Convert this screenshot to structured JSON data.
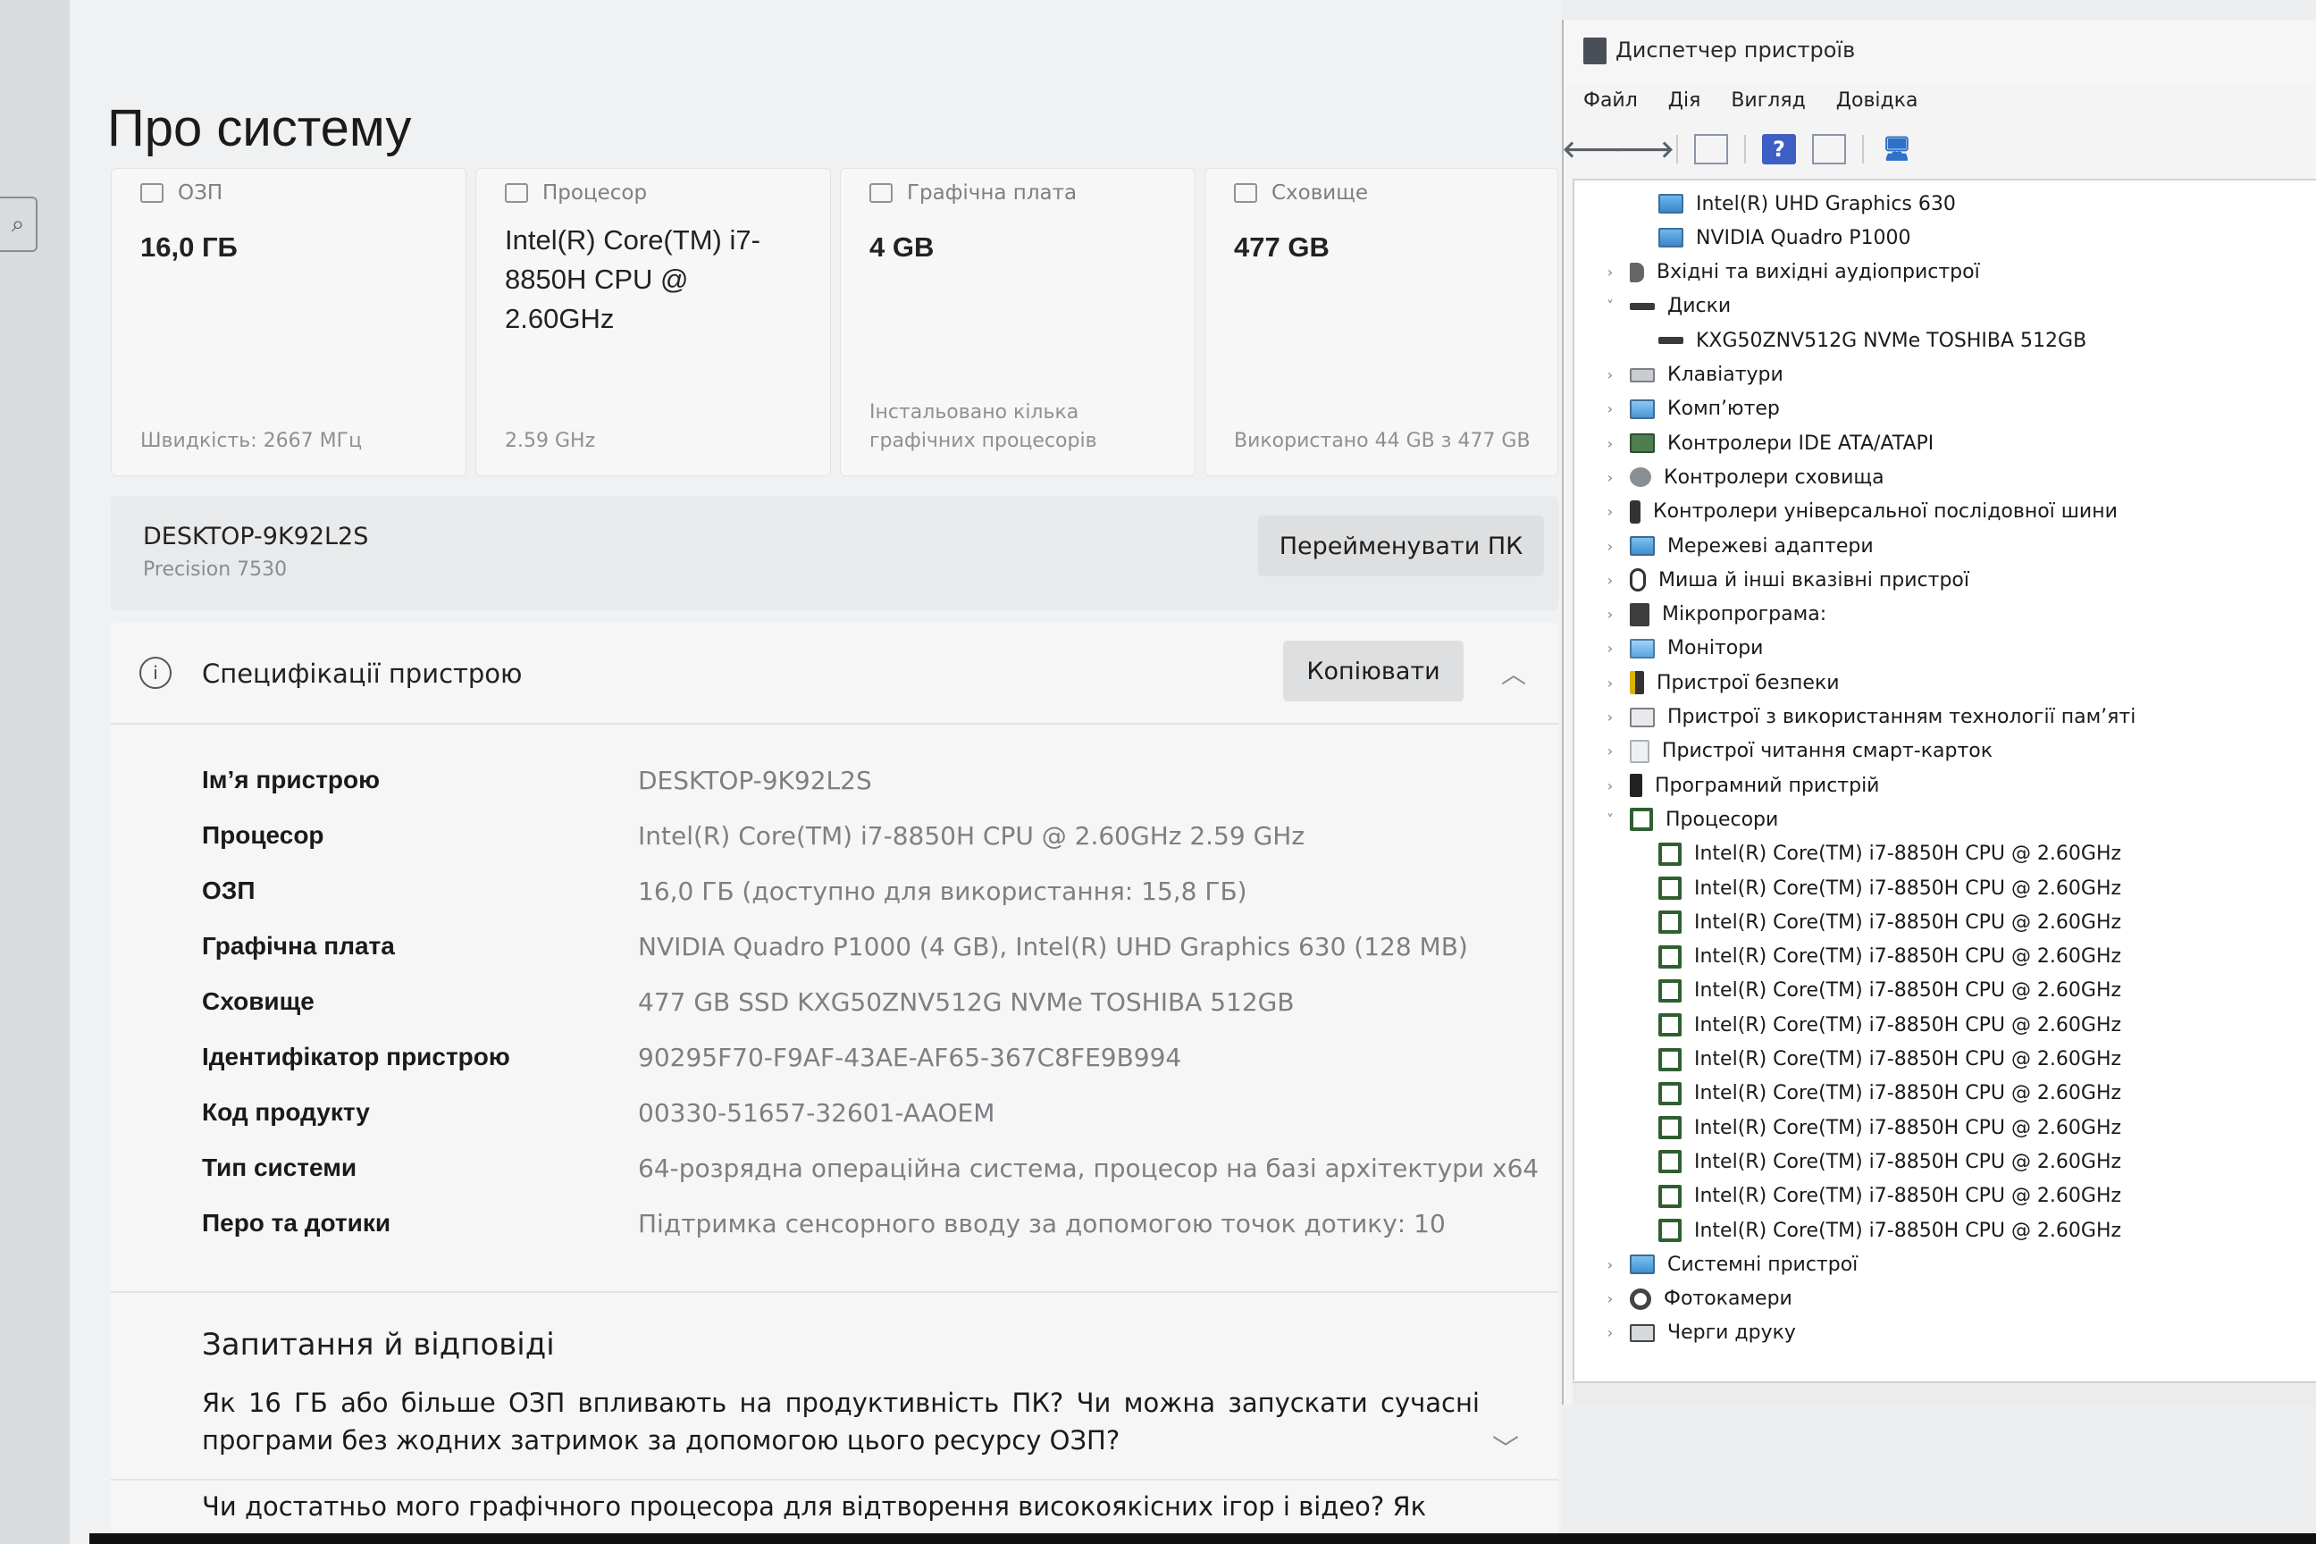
{
  "settings": {
    "page_title": "Про систему",
    "cards": [
      {
        "label": "ОЗП",
        "value": "16,0 ГБ",
        "footer": "Швидкість: 2667 МГц"
      },
      {
        "label": "Процесор",
        "value": "Intel(R) Core(TM) i7-8850H CPU @ 2.60GHz",
        "footer": "2.59 GHz"
      },
      {
        "label": "Графічна плата",
        "value": "4 GB",
        "footer": "Інстальовано кілька графічних процесорів"
      },
      {
        "label": "Сховище",
        "value": "477 GB",
        "footer": "Використано 44 GB з 477 GB"
      }
    ],
    "pc_name": "DESKTOP-9K92L2S",
    "pc_model": "Precision 7530",
    "rename_button": "Перейменувати ПК",
    "spec_title": "Специфікації пристрою",
    "copy_button": "Копіювати",
    "specs": [
      {
        "label": "Ім’я пристрою",
        "value": "DESKTOP-9K92L2S"
      },
      {
        "label": "Процесор",
        "value": "Intel(R) Core(TM) i7-8850H CPU @ 2.60GHz   2.59 GHz"
      },
      {
        "label": "ОЗП",
        "value": "16,0 ГБ (доступно для використання: 15,8 ГБ)"
      },
      {
        "label": "Графічна плата",
        "value": "NVIDIA Quadro P1000 (4 GB), Intel(R) UHD Graphics 630 (128 MB)"
      },
      {
        "label": "Сховище",
        "value": "477 GB SSD KXG50ZNV512G NVMe TOSHIBA 512GB"
      },
      {
        "label": "Ідентифікатор пристрою",
        "value": "90295F70-F9AF-43AE-AF65-367C8FE9B994"
      },
      {
        "label": "Код продукту",
        "value": "00330-51657-32601-AAOEM"
      },
      {
        "label": "Тип системи",
        "value": "64-розрядна операційна система, процесор на базі архітектури x64"
      },
      {
        "label": "Перо та дотики",
        "value": "Підтримка сенсорного вводу за допомогою точок дотику: 10"
      }
    ],
    "faq_title": "Запитання й відповіді",
    "faq": [
      "Як 16 ГБ або більше ОЗП впливають на продуктивність ПК? Чи можна запускати сучасні програми без жодних затримок за допомогою цього ресурсу ОЗП?",
      "Чи достатньо мого графічного процесора для відтворення високоякісних ігор і відео? Як"
    ]
  },
  "device_manager": {
    "title": "Диспетчер пристроїв",
    "menu": [
      "Файл",
      "Дія",
      "Вигляд",
      "Довідка"
    ],
    "tree": [
      {
        "label": "Intel(R) UHD Graphics 630",
        "level": 2,
        "icon": "gpu-icon",
        "arrow": ""
      },
      {
        "label": "NVIDIA Quadro P1000",
        "level": 2,
        "icon": "gpu-icon",
        "arrow": ""
      },
      {
        "label": "Вхідні та вихідні аудіопристрої",
        "level": 1,
        "icon": "audio-icon",
        "arrow": "›"
      },
      {
        "label": "Диски",
        "level": 1,
        "icon": "disk-icon",
        "arrow": "˅"
      },
      {
        "label": "KXG50ZNV512G NVMe TOSHIBA 512GB",
        "level": 2,
        "icon": "disk-icon",
        "arrow": ""
      },
      {
        "label": "Клавіатури",
        "level": 1,
        "icon": "keyboard-icon",
        "arrow": "›"
      },
      {
        "label": "Комп’ютер",
        "level": 1,
        "icon": "computer-icon",
        "arrow": "›"
      },
      {
        "label": "Контролери IDE ATA/ATAPI",
        "level": 1,
        "icon": "ide-controller-icon",
        "arrow": "›"
      },
      {
        "label": "Контролери сховища",
        "level": 1,
        "icon": "storage-controller-icon",
        "arrow": "›"
      },
      {
        "label": "Контролери універсальної послідовної шини",
        "level": 1,
        "icon": "usb-icon",
        "arrow": "›"
      },
      {
        "label": "Мережеві адаптери",
        "level": 1,
        "icon": "network-adapter-icon",
        "arrow": "›"
      },
      {
        "label": "Миша й інші вказівні пристрої",
        "level": 1,
        "icon": "mouse-icon",
        "arrow": "›"
      },
      {
        "label": "Мікропрограма:",
        "level": 1,
        "icon": "firmware-icon",
        "arrow": "›"
      },
      {
        "label": "Монітори",
        "level": 1,
        "icon": "monitor-icon",
        "arrow": "›"
      },
      {
        "label": "Пристрої безпеки",
        "level": 1,
        "icon": "security-device-icon",
        "arrow": "›"
      },
      {
        "label": "Пристрої з використанням технології пам’яті",
        "level": 1,
        "icon": "memory-device-icon",
        "arrow": "›"
      },
      {
        "label": "Пристрої читання смарт-карток",
        "level": 1,
        "icon": "smart-card-reader-icon",
        "arrow": "›"
      },
      {
        "label": "Програмний пристрій",
        "level": 1,
        "icon": "software-device-icon",
        "arrow": "›"
      },
      {
        "label": "Процесори",
        "level": 1,
        "icon": "processor-icon",
        "arrow": "˅"
      },
      {
        "label": "Intel(R) Core(TM) i7-8850H CPU @ 2.60GHz",
        "level": 2,
        "icon": "processor-icon",
        "arrow": ""
      },
      {
        "label": "Intel(R) Core(TM) i7-8850H CPU @ 2.60GHz",
        "level": 2,
        "icon": "processor-icon",
        "arrow": ""
      },
      {
        "label": "Intel(R) Core(TM) i7-8850H CPU @ 2.60GHz",
        "level": 2,
        "icon": "processor-icon",
        "arrow": ""
      },
      {
        "label": "Intel(R) Core(TM) i7-8850H CPU @ 2.60GHz",
        "level": 2,
        "icon": "processor-icon",
        "arrow": ""
      },
      {
        "label": "Intel(R) Core(TM) i7-8850H CPU @ 2.60GHz",
        "level": 2,
        "icon": "processor-icon",
        "arrow": ""
      },
      {
        "label": "Intel(R) Core(TM) i7-8850H CPU @ 2.60GHz",
        "level": 2,
        "icon": "processor-icon",
        "arrow": ""
      },
      {
        "label": "Intel(R) Core(TM) i7-8850H CPU @ 2.60GHz",
        "level": 2,
        "icon": "processor-icon",
        "arrow": ""
      },
      {
        "label": "Intel(R) Core(TM) i7-8850H CPU @ 2.60GHz",
        "level": 2,
        "icon": "processor-icon",
        "arrow": ""
      },
      {
        "label": "Intel(R) Core(TM) i7-8850H CPU @ 2.60GHz",
        "level": 2,
        "icon": "processor-icon",
        "arrow": ""
      },
      {
        "label": "Intel(R) Core(TM) i7-8850H CPU @ 2.60GHz",
        "level": 2,
        "icon": "processor-icon",
        "arrow": ""
      },
      {
        "label": "Intel(R) Core(TM) i7-8850H CPU @ 2.60GHz",
        "level": 2,
        "icon": "processor-icon",
        "arrow": ""
      },
      {
        "label": "Intel(R) Core(TM) i7-8850H CPU @ 2.60GHz",
        "level": 2,
        "icon": "processor-icon",
        "arrow": ""
      },
      {
        "label": "Системні пристрої",
        "level": 1,
        "icon": "system-device-icon",
        "arrow": "›"
      },
      {
        "label": "Фотокамери",
        "level": 1,
        "icon": "camera-icon",
        "arrow": "›"
      },
      {
        "label": "Черги друку",
        "level": 1,
        "icon": "print-queue-icon",
        "arrow": "›"
      }
    ]
  }
}
